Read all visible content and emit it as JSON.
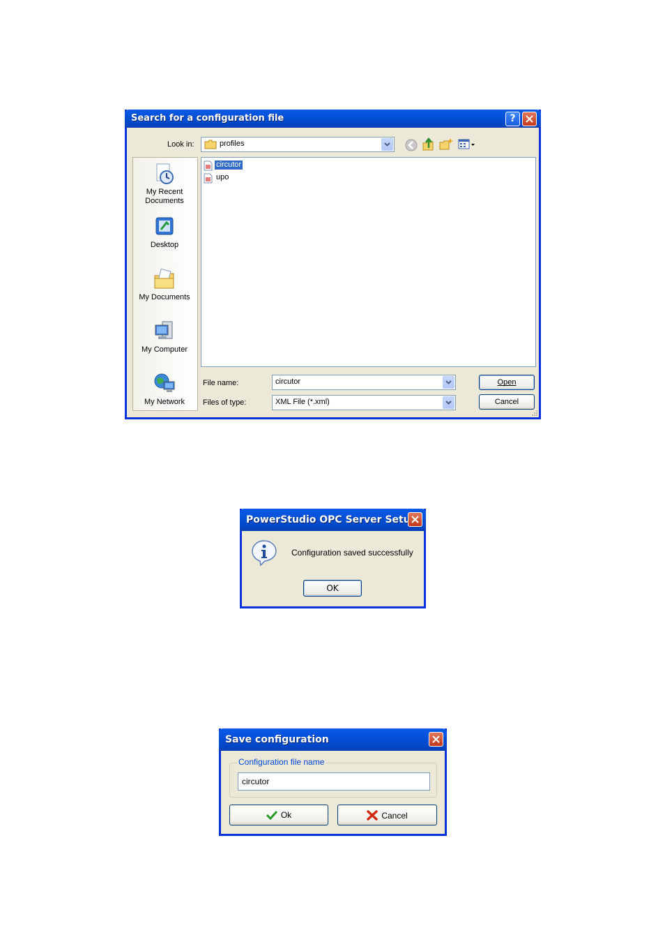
{
  "open_dialog": {
    "title": "Search for a configuration file",
    "look_in_label": "Look in:",
    "look_in_value": "profiles",
    "places": [
      {
        "label_line1": "My Recent",
        "label_line2": "Documents",
        "icon": "recent-documents-icon"
      },
      {
        "label_line1": "Desktop",
        "label_line2": "",
        "icon": "desktop-icon"
      },
      {
        "label_line1": "My Documents",
        "label_line2": "",
        "icon": "my-documents-icon"
      },
      {
        "label_line1": "My Computer",
        "label_line2": "",
        "icon": "my-computer-icon"
      },
      {
        "label_line1": "My Network",
        "label_line2": "",
        "icon": "my-network-icon"
      }
    ],
    "files": [
      {
        "name": "circutor",
        "selected": true
      },
      {
        "name": "upo",
        "selected": false
      }
    ],
    "file_name_label": "File name:",
    "file_name_value": "circutor",
    "files_of_type_label": "Files of type:",
    "files_of_type_value": "XML File (*.xml)",
    "open_label": "Open",
    "cancel_label": "Cancel"
  },
  "message_dialog": {
    "title": "PowerStudio OPC Server Setup",
    "message": "Configuration saved successfully",
    "ok_label": "OK"
  },
  "save_dialog": {
    "title": "Save configuration",
    "group_label": "Configuration file name",
    "file_name_value": "circutor",
    "ok_label": "Ok",
    "cancel_label": "Cancel"
  },
  "colors": {
    "titlebar": "#0450d5",
    "window_bg": "#ece9d8",
    "selection": "#316ac5",
    "close_button": "#c3371a"
  }
}
